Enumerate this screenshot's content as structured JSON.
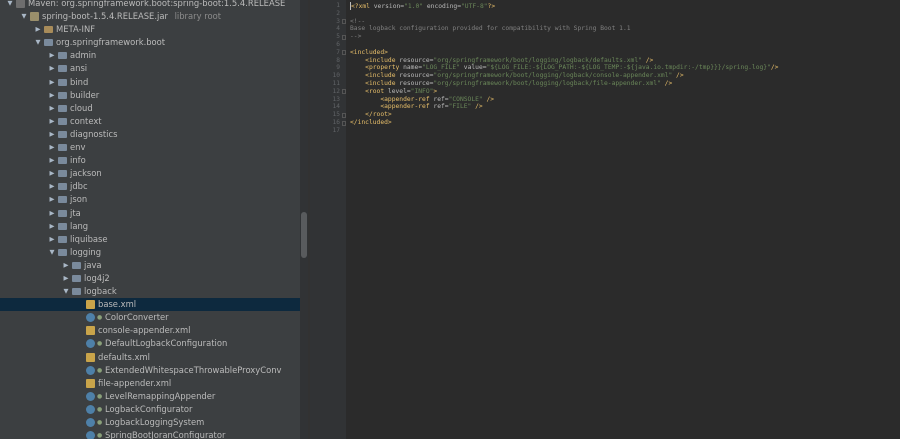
{
  "project_tree": {
    "rows": [
      {
        "level": 0,
        "arrow": "▼",
        "icon": "maven",
        "label": "Maven: org.springframework.boot:spring-boot:1.5.4.RELEASE",
        "suffix": ""
      },
      {
        "level": 1,
        "arrow": "▼",
        "icon": "jar",
        "label": "spring-boot-1.5.4.RELEASE.jar",
        "suffix": "library root"
      },
      {
        "level": 2,
        "arrow": "▶",
        "icon": "folder",
        "label": "META-INF",
        "suffix": ""
      },
      {
        "level": 2,
        "arrow": "▼",
        "icon": "pkg",
        "label": "org.springframework.boot",
        "suffix": ""
      },
      {
        "level": 3,
        "arrow": "▶",
        "icon": "pkg",
        "label": "admin",
        "suffix": ""
      },
      {
        "level": 3,
        "arrow": "▶",
        "icon": "pkg",
        "label": "ansi",
        "suffix": ""
      },
      {
        "level": 3,
        "arrow": "▶",
        "icon": "pkg",
        "label": "bind",
        "suffix": ""
      },
      {
        "level": 3,
        "arrow": "▶",
        "icon": "pkg",
        "label": "builder",
        "suffix": ""
      },
      {
        "level": 3,
        "arrow": "▶",
        "icon": "pkg",
        "label": "cloud",
        "suffix": ""
      },
      {
        "level": 3,
        "arrow": "▶",
        "icon": "pkg",
        "label": "context",
        "suffix": ""
      },
      {
        "level": 3,
        "arrow": "▶",
        "icon": "pkg",
        "label": "diagnostics",
        "suffix": ""
      },
      {
        "level": 3,
        "arrow": "▶",
        "icon": "pkg",
        "label": "env",
        "suffix": ""
      },
      {
        "level": 3,
        "arrow": "▶",
        "icon": "pkg",
        "label": "info",
        "suffix": ""
      },
      {
        "level": 3,
        "arrow": "▶",
        "icon": "pkg",
        "label": "jackson",
        "suffix": ""
      },
      {
        "level": 3,
        "arrow": "▶",
        "icon": "pkg",
        "label": "jdbc",
        "suffix": ""
      },
      {
        "level": 3,
        "arrow": "▶",
        "icon": "pkg",
        "label": "json",
        "suffix": ""
      },
      {
        "level": 3,
        "arrow": "▶",
        "icon": "pkg",
        "label": "jta",
        "suffix": ""
      },
      {
        "level": 3,
        "arrow": "▶",
        "icon": "pkg",
        "label": "lang",
        "suffix": ""
      },
      {
        "level": 3,
        "arrow": "▶",
        "icon": "pkg",
        "label": "liquibase",
        "suffix": ""
      },
      {
        "level": 3,
        "arrow": "▼",
        "icon": "pkg",
        "label": "logging",
        "suffix": ""
      },
      {
        "level": 4,
        "arrow": "▶",
        "icon": "pkg",
        "label": "java",
        "suffix": ""
      },
      {
        "level": 4,
        "arrow": "▶",
        "icon": "pkg",
        "label": "log4j2",
        "suffix": ""
      },
      {
        "level": 4,
        "arrow": "▼",
        "icon": "pkg",
        "label": "logback",
        "suffix": ""
      },
      {
        "level": 5,
        "arrow": "",
        "icon": "xml",
        "label": "base.xml",
        "suffix": "",
        "selected": true
      },
      {
        "level": 5,
        "arrow": "",
        "icon": "cls",
        "label": "ColorConverter",
        "suffix": "",
        "lock": true
      },
      {
        "level": 5,
        "arrow": "",
        "icon": "xml",
        "label": "console-appender.xml",
        "suffix": ""
      },
      {
        "level": 5,
        "arrow": "",
        "icon": "cls",
        "label": "DefaultLogbackConfiguration",
        "suffix": "",
        "lock": true
      },
      {
        "level": 5,
        "arrow": "",
        "icon": "xml",
        "label": "defaults.xml",
        "suffix": ""
      },
      {
        "level": 5,
        "arrow": "",
        "icon": "cls",
        "label": "ExtendedWhitespaceThrowableProxyConv",
        "suffix": "",
        "lock": true
      },
      {
        "level": 5,
        "arrow": "",
        "icon": "xml",
        "label": "file-appender.xml",
        "suffix": ""
      },
      {
        "level": 5,
        "arrow": "",
        "icon": "cls",
        "label": "LevelRemappingAppender",
        "suffix": "",
        "lock": true
      },
      {
        "level": 5,
        "arrow": "",
        "icon": "cls",
        "label": "LogbackConfigurator",
        "suffix": "",
        "lock": true
      },
      {
        "level": 5,
        "arrow": "",
        "icon": "cls",
        "label": "LogbackLoggingSystem",
        "suffix": "",
        "lock": true
      },
      {
        "level": 5,
        "arrow": "",
        "icon": "cls",
        "label": "SpringBootJoranConfigurator",
        "suffix": "",
        "lock": true
      }
    ]
  },
  "editor": {
    "line_numbers": [
      "1",
      "2",
      "3",
      "4",
      "5",
      "6",
      "7",
      "8",
      "9",
      "10",
      "11",
      "12",
      "13",
      "14",
      "15",
      "16",
      "17"
    ],
    "lines": [
      [
        {
          "t": "<?",
          "c": "tag"
        },
        {
          "t": "xml ",
          "c": "tag"
        },
        {
          "t": "version=",
          "c": "attr"
        },
        {
          "t": "\"1.0\"",
          "c": "val"
        },
        {
          "t": " encoding=",
          "c": "attr"
        },
        {
          "t": "\"UTF-8\"",
          "c": "val"
        },
        {
          "t": "?>",
          "c": "tag"
        }
      ],
      [],
      [
        {
          "t": "<!--",
          "c": "cmt"
        }
      ],
      [
        {
          "t": "Base logback configuration provided for compatibility with Spring Boot 1.1",
          "c": "cmt"
        }
      ],
      [
        {
          "t": "-->",
          "c": "cmt"
        }
      ],
      [],
      [
        {
          "t": "<included>",
          "c": "tag"
        }
      ],
      [
        {
          "t": "    "
        },
        {
          "t": "<include ",
          "c": "tag"
        },
        {
          "t": "resource=",
          "c": "attr"
        },
        {
          "t": "\"org/springframework/boot/logging/logback/defaults.xml\"",
          "c": "val"
        },
        {
          "t": " />",
          "c": "tag"
        }
      ],
      [
        {
          "t": "    "
        },
        {
          "t": "<property ",
          "c": "tag"
        },
        {
          "t": "name=",
          "c": "attr"
        },
        {
          "t": "\"LOG_FILE\"",
          "c": "val"
        },
        {
          "t": " value=",
          "c": "attr"
        },
        {
          "t": "\"${LOG_FILE:-${LOG_PATH:-${LOG_TEMP:-${java.io.tmpdir:-/tmp}}}/spring.log}\"",
          "c": "val"
        },
        {
          "t": "/>",
          "c": "tag"
        }
      ],
      [
        {
          "t": "    "
        },
        {
          "t": "<include ",
          "c": "tag"
        },
        {
          "t": "resource=",
          "c": "attr"
        },
        {
          "t": "\"org/springframework/boot/logging/logback/console-appender.xml\"",
          "c": "val"
        },
        {
          "t": " />",
          "c": "tag"
        }
      ],
      [
        {
          "t": "    "
        },
        {
          "t": "<include ",
          "c": "tag"
        },
        {
          "t": "resource=",
          "c": "attr"
        },
        {
          "t": "\"org/springframework/boot/logging/logback/file-appender.xml\"",
          "c": "val"
        },
        {
          "t": " />",
          "c": "tag"
        }
      ],
      [
        {
          "t": "    "
        },
        {
          "t": "<root ",
          "c": "tag"
        },
        {
          "t": "level=",
          "c": "attr"
        },
        {
          "t": "\"INFO\"",
          "c": "val"
        },
        {
          "t": ">",
          "c": "tag"
        }
      ],
      [
        {
          "t": "        "
        },
        {
          "t": "<appender-ref ",
          "c": "tag"
        },
        {
          "t": "ref=",
          "c": "attr"
        },
        {
          "t": "\"CONSOLE\"",
          "c": "val"
        },
        {
          "t": " />",
          "c": "tag"
        }
      ],
      [
        {
          "t": "        "
        },
        {
          "t": "<appender-ref ",
          "c": "tag"
        },
        {
          "t": "ref=",
          "c": "attr"
        },
        {
          "t": "\"FILE\"",
          "c": "val"
        },
        {
          "t": " />",
          "c": "tag"
        }
      ],
      [
        {
          "t": "    "
        },
        {
          "t": "</root>",
          "c": "tag"
        }
      ],
      [
        {
          "t": "</included>",
          "c": "tag"
        }
      ],
      []
    ]
  },
  "colors": {
    "panel_bg": "#3c3f41",
    "editor_bg": "#2b2b2b",
    "selection_bg": "#0d293e",
    "xml_tag": "#e8bf6a",
    "xml_value": "#6a8759",
    "comment": "#808080"
  },
  "icons": {
    "maven": "maven-library-icon",
    "jar": "jar-icon",
    "folder": "folder-icon",
    "pkg": "package-icon",
    "xml": "xml-file-icon",
    "cls": "class-icon"
  }
}
